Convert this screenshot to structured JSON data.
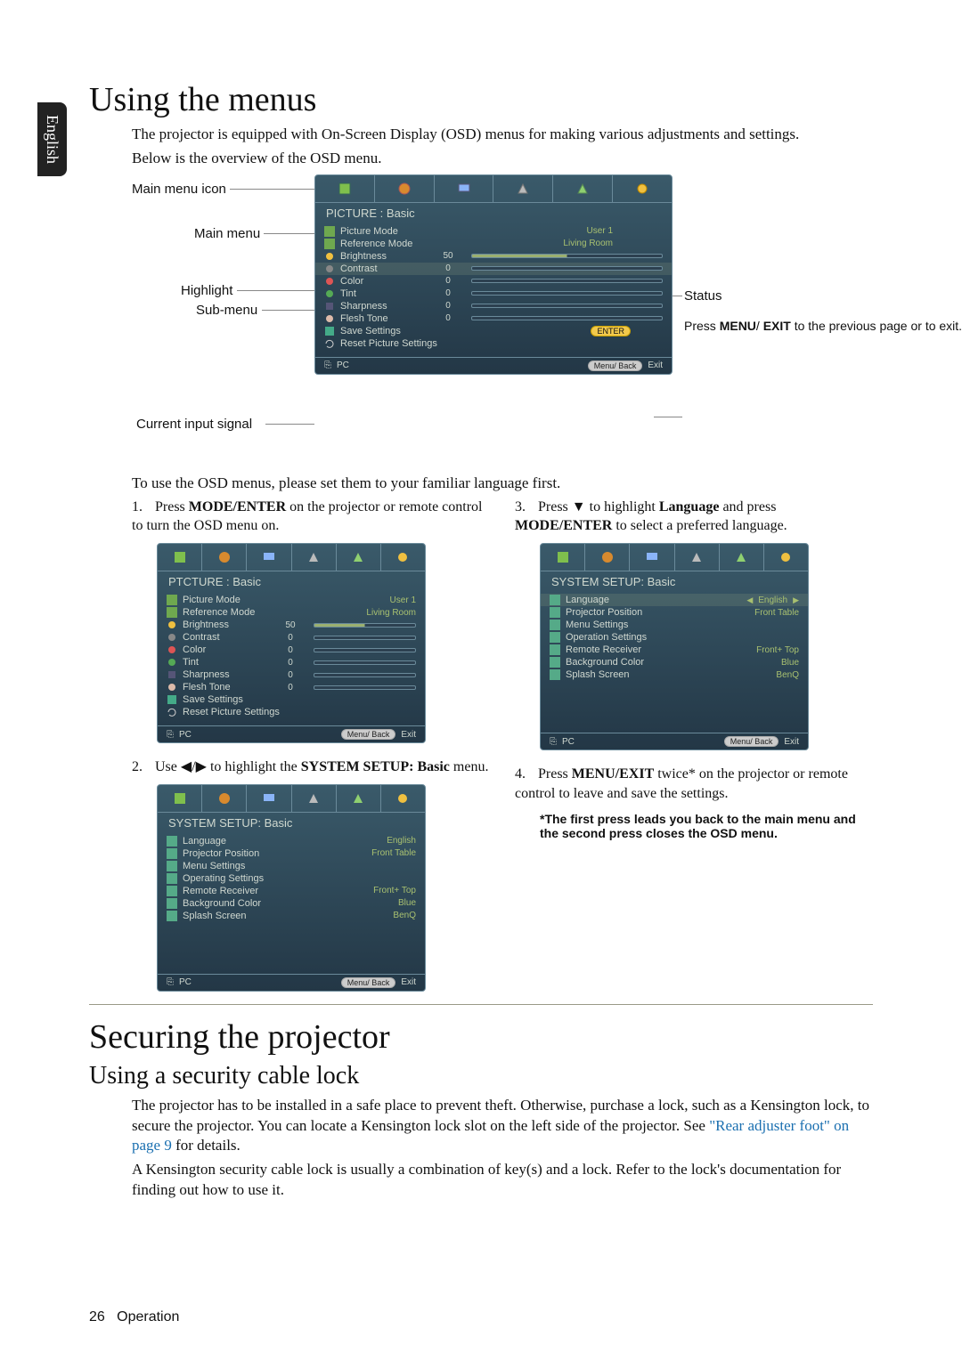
{
  "sidebar_language": "English",
  "heading1": "Using the menus",
  "intro_p1": "The projector is equipped with On-Screen Display (OSD) menus for making various adjustments and settings.",
  "intro_p2": "Below is the overview of the OSD menu.",
  "callouts": {
    "main_menu_icon": "Main menu icon",
    "main_menu": "Main menu",
    "highlight": "Highlight",
    "sub_menu": "Sub-menu",
    "status": "Status",
    "press_menu": "Press MENU/ EXIT to the previous page or to exit.",
    "current_input": "Current input signal"
  },
  "osd_main": {
    "title": "PICTURE : Basic",
    "rows": [
      {
        "label": "Picture Mode",
        "right": "User 1",
        "slider": true
      },
      {
        "label": "Reference Mode",
        "right": "Living Room",
        "slider": true
      },
      {
        "label": "Brightness",
        "val": "50",
        "slider": true
      },
      {
        "label": "Contrast",
        "val": "0",
        "slider": true,
        "zero": true,
        "highlighted": true
      },
      {
        "label": "Color",
        "val": "0",
        "slider": true,
        "zero": true
      },
      {
        "label": "Tint",
        "val": "0",
        "slider": true,
        "zero": true
      },
      {
        "label": "Sharpness",
        "val": "0",
        "slider": true,
        "zero": true
      },
      {
        "label": "Flesh Tone",
        "val": "0",
        "slider": true,
        "zero": true
      },
      {
        "label": "Save Settings",
        "enter": true
      },
      {
        "label": "Reset Picture Settings"
      }
    ],
    "foot_input": "PC",
    "foot_pill": "Menu/ Back",
    "foot_exit": "Exit",
    "enter_label": "ENTER"
  },
  "p_language": "To use the OSD menus, please set them to your familiar language first.",
  "step1": {
    "num": "1.",
    "text_a": "Press ",
    "b1": "MODE/ENTER",
    "text_b": " on the projector or remote control to turn the OSD menu on."
  },
  "osd_step1": {
    "title": "PTCTURE : Basic",
    "rows": [
      {
        "label": "Picture Mode",
        "right": "User 1",
        "slider": true
      },
      {
        "label": "Reference Mode",
        "right": "Living Room",
        "slider": true
      },
      {
        "label": "Brightness",
        "val": "50",
        "slider": true
      },
      {
        "label": "Contrast",
        "val": "0",
        "slider": true,
        "zero": true
      },
      {
        "label": "Color",
        "val": "0",
        "slider": true,
        "zero": true
      },
      {
        "label": "Tint",
        "val": "0",
        "slider": true,
        "zero": true
      },
      {
        "label": "Sharpness",
        "val": "0",
        "slider": true,
        "zero": true
      },
      {
        "label": "Flesh Tone",
        "val": "0",
        "slider": true,
        "zero": true
      },
      {
        "label": "Save Settings"
      },
      {
        "label": "Reset Picture Settings"
      }
    ],
    "foot_input": "PC",
    "foot_pill": "Menu/ Back",
    "foot_exit": "Exit"
  },
  "step2": {
    "num": "2.",
    "text_a": "Use ",
    "text_b": " to highlight the ",
    "b1": "SYSTEM SETUP: Basic",
    "text_c": " menu."
  },
  "osd_step2": {
    "title": "SYSTEM SETUP: Basic",
    "rows": [
      {
        "label": "Language",
        "right": "English"
      },
      {
        "label": "Projector Position",
        "right": "Front Table"
      },
      {
        "label": "Menu Settings"
      },
      {
        "label": "Operating Settings"
      },
      {
        "label": "Remote Receiver",
        "right": "Front+ Top"
      },
      {
        "label": "Background Color",
        "right": "Blue"
      },
      {
        "label": "Splash Screen",
        "right": "BenQ"
      }
    ],
    "foot_input": "PC",
    "foot_pill": "Menu/ Back",
    "foot_exit": "Exit"
  },
  "step3": {
    "num": "3.",
    "text_a": "Press ",
    "text_b": " to highlight ",
    "b1": "Language",
    "text_c": " and press ",
    "b2": "MODE/ENTER",
    "text_d": " to select a preferred language."
  },
  "osd_step3": {
    "title": "SYSTEM SETUP: Basic",
    "rows": [
      {
        "label": "Language",
        "right": "English",
        "highlighted": true,
        "arrows": true
      },
      {
        "label": "Projector Position",
        "right": "Front Table"
      },
      {
        "label": "Menu Settings"
      },
      {
        "label": "Operation Settings"
      },
      {
        "label": "Remote Receiver",
        "right": "Front+ Top"
      },
      {
        "label": "Background Color",
        "right": "Blue"
      },
      {
        "label": "Splash Screen",
        "right": "BenQ"
      }
    ],
    "foot_input": "PC",
    "foot_pill": "Menu/ Back",
    "foot_exit": "Exit"
  },
  "step4": {
    "num": "4.",
    "text_a": "Press ",
    "b1": "MENU/EXIT",
    "text_b": " twice* on the projector or remote control to leave and save the settings."
  },
  "step4_note": "*The first press leads you back to the main menu and the second press closes the OSD menu.",
  "heading2": "Securing the projector",
  "heading2b": "Using a security cable lock",
  "sec_p1a": "The projector has to be installed in a safe place to prevent theft. Otherwise, purchase a lock, such as a Kensington lock, to secure the projector. You can locate a Kensington lock slot on the left side of the projector. See ",
  "sec_link": "\"Rear adjuster foot\" on page 9",
  "sec_p1b": " for details.",
  "sec_p2": "A Kensington security cable lock is usually a combination of key(s) and a lock. Refer to the lock's documentation for finding out how to use it.",
  "footer_num": "26",
  "footer_label": "Operation",
  "icons": {
    "input": "⎘"
  }
}
